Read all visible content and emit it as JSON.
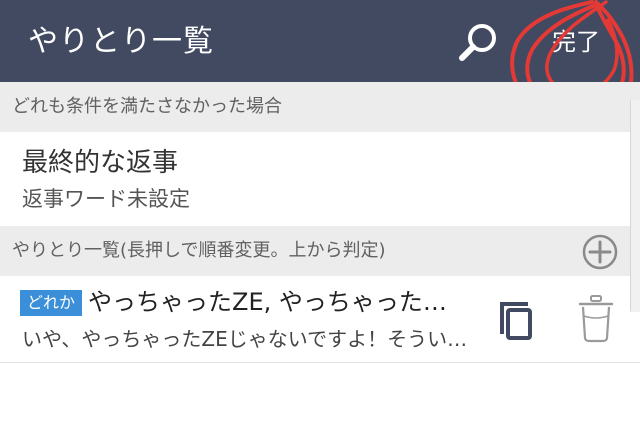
{
  "header": {
    "title": "やりとり一覧",
    "done_label": "完了",
    "search_icon": "search-icon"
  },
  "section_default": {
    "label": "どれも条件を満たさなかった場合"
  },
  "final_reply": {
    "title": "最終的な返事",
    "subtitle": "返事ワード未設定"
  },
  "section_list": {
    "label": "やりとり一覧(長押しで順番変更。上から判定)",
    "add_icon": "add-circle-icon"
  },
  "items": [
    {
      "badge": "どれか",
      "title": "やっちゃったZE, やっちゃったZE...",
      "reply": "いや、やっちゃったZEじゃないですよ！そういう時は..."
    }
  ],
  "colors": {
    "header_bg": "#424a61",
    "section_bg": "#ececec",
    "badge_bg": "#3b8ed8",
    "scribble": "#e53935"
  }
}
